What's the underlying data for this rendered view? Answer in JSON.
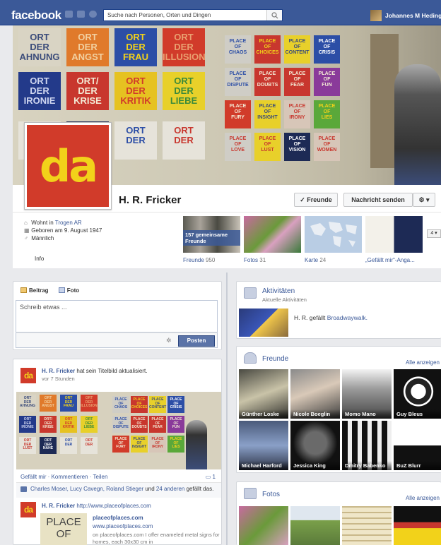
{
  "topbar": {
    "logo": "facebook",
    "search_placeholder": "Suche nach Personen, Orten und Dingen",
    "user_name": "Johannes M Hedinger"
  },
  "profile": {
    "name": "H. R. Fricker",
    "avatar_text": "da",
    "friends_button": "✓ Freunde",
    "message_button": "Nachricht senden",
    "gear_button": "⚙ ▾"
  },
  "cover": {
    "signs_left": [
      {
        "text": "ORT DER AHNUNG",
        "color": "#d9d4c4",
        "fg": "#3b4c7a"
      },
      {
        "text": "ORT DER ANGST",
        "color": "#e07a2b",
        "fg": "#f2d0a0"
      },
      {
        "text": "ORT DER FRAU",
        "color": "#2c4ea6",
        "fg": "#f2d21a"
      },
      {
        "text": "ORT DER ILLUSION",
        "color": "#d13b2a",
        "fg": "#e9a070"
      },
      {
        "text": "ORT DER IRONIE",
        "color": "#233a8a",
        "fg": "#cfd6f0"
      },
      {
        "text": "ORT/ DER KRISE",
        "color": "#c8372e",
        "fg": "#f3ead5"
      },
      {
        "text": "ORT DER KRITIK",
        "color": "#e6c221",
        "fg": "#d13b2a"
      },
      {
        "text": "ORT DER LIEBE",
        "color": "#e8d02a",
        "fg": "#3b8a3a"
      },
      {
        "text": "ORT DER LUST",
        "color": "#e6e3da",
        "fg": "#c8372e"
      },
      {
        "text": "ORT DER NÄHE",
        "color": "#1d2a55",
        "fg": "#ffffff"
      },
      {
        "text": "ORT DER",
        "color": "#e6e3da",
        "fg": "#2c4ea6"
      },
      {
        "text": "ORT DER",
        "color": "#e6e3da",
        "fg": "#c8372e"
      }
    ],
    "signs_right": [
      {
        "text": "PLACE OF CHAOS",
        "color": "#cfcdc6",
        "fg": "#2c4ea6"
      },
      {
        "text": "PLACE OF CHOICES",
        "color": "#c8372e",
        "fg": "#f2d21a"
      },
      {
        "text": "PLACE OF CONTENT",
        "color": "#e8d02a",
        "fg": "#3b4c7a"
      },
      {
        "text": "PLACE OF CRISIS",
        "color": "#2c4ea6",
        "fg": "#ffffff"
      },
      {
        "text": "PLACE OF DISPUTE",
        "color": "#cfcdc6",
        "fg": "#2c4ea6"
      },
      {
        "text": "PLACE OF DOUBTS",
        "color": "#c8372e",
        "fg": "#f3ead5"
      },
      {
        "text": "PLACE OF FEAR",
        "color": "#c8372e",
        "fg": "#f3ead5"
      },
      {
        "text": "PLACE OF FUN",
        "color": "#8a3a9a",
        "fg": "#f3ead5"
      },
      {
        "text": "PLACE OF FURY",
        "color": "#d13b2a",
        "fg": "#f3ead5"
      },
      {
        "text": "PLACE OF INSIGHT",
        "color": "#e8d02a",
        "fg": "#3b4c7a"
      },
      {
        "text": "PLACE OF IRONY",
        "color": "#d7c6b8",
        "fg": "#c8372e"
      },
      {
        "text": "PLACE OF LIES",
        "color": "#5aa83a",
        "fg": "#f2d21a"
      },
      {
        "text": "PLACE OF LOVE",
        "color": "#cfcdc6",
        "fg": "#c8372e"
      },
      {
        "text": "PLACE OF LUST",
        "color": "#e8d02a",
        "fg": "#c8372e"
      },
      {
        "text": "PLACE OF VISION",
        "color": "#1d2a55",
        "fg": "#ffffff"
      },
      {
        "text": "PLACE OF WOMEN",
        "color": "#d7c6b8",
        "fg": "#c8372e"
      }
    ]
  },
  "info": {
    "lives_prefix": "Wohnt in",
    "lives_place": "Trogen AR",
    "born": "Geboren am 9. August 1947",
    "gender": "Männlich",
    "tab_info": "Info"
  },
  "thumbs": {
    "friends_overlay": "157 gemeinsame Freunde",
    "friends_label": "Freunde",
    "friends_count": "950",
    "photos_label": "Fotos",
    "photos_count": "31",
    "map_label": "Karte",
    "map_count": "24",
    "likes_label": "„Gefällt mir“-Anga...",
    "more_label": "4 ▾"
  },
  "composer": {
    "tab_post": "Beitrag",
    "tab_photo": "Foto",
    "placeholder": "Schreib etwas ...",
    "post_button": "Posten"
  },
  "feed": {
    "author": "H. R. Fricker",
    "action": " hat sein Titelbild aktualisiert.",
    "time": "vor 7 Stunden",
    "actions": "Gefällt mir · Kommentieren · Teilen",
    "comment_count": "1",
    "likes_names": "Charles Moser, Lucy Cavegn, Roland Stieger",
    "likes_and": " und ",
    "likes_others": "24 anderen",
    "likes_suffix": " gefällt das.",
    "post2_author": "H. R. Fricker",
    "post2_url": "http://www.placeofplaces.com",
    "preview_pic": "PLACE OF",
    "preview_title": "placeofplaces.com",
    "preview_url": "www.placeofplaces.com",
    "preview_desc": "on placeofplaces.com I offer enameled metal signs for homes, each 30x30 cm in"
  },
  "activities": {
    "title": "Aktivitäten",
    "subtitle": "Aktuelle Aktivitäten",
    "actor": "H. R.",
    "verb": " gefällt ",
    "object": "Broadwaywalk."
  },
  "friends": {
    "title": "Freunde",
    "see_all": "Alle anzeigen",
    "items": [
      {
        "name": "Günther Loske",
        "bg": "linear-gradient(160deg,#4a4a42,#c9c3a8 50%,#2e2e2a)"
      },
      {
        "name": "Nicole Boeglin",
        "bg": "linear-gradient(160deg,#8a8a8a,#d9c9b8 45%,#3a3a3a)"
      },
      {
        "name": "Momo Mano",
        "bg": "linear-gradient(180deg,#f3f3f3,#9a9a9a 40%,#444)"
      },
      {
        "name": "Guy Bleus",
        "bg": "radial-gradient(circle at 50% 45%,#fff 0 20%,#222 21% 35%,#fff 36% 40%,#111 41%)"
      },
      {
        "name": "Michael Harford",
        "bg": "linear-gradient(180deg,#4a5a7a,#8aa0c8 50%,#2a3042)"
      },
      {
        "name": "Jessica King",
        "bg": "radial-gradient(circle at 50% 45%,#6a6a6a 0 30%,#111 60%)"
      },
      {
        "name": "Dmitry Babenko",
        "bg": "repeating-linear-gradient(90deg,#111 0 8px,#eee 8px 14px)"
      },
      {
        "name": "BuZ Blurr",
        "bg": "linear-gradient(180deg,#fff 0 50%,#111 50%)"
      }
    ]
  },
  "photos": {
    "title": "Fotos",
    "see_all": "Alle anzeigen",
    "items": [
      {
        "bg": "linear-gradient(135deg,#c86aa0,#6a9a3a 50%,#d9a0c0)"
      },
      {
        "bg": "linear-gradient(180deg,#dfe7ef 0 35%,#7aa04a 36%,#5a7a3a)"
      },
      {
        "bg": "repeating-linear-gradient(0deg,#efe6c8 0 6px,#c9b88a 6px 8px)"
      },
      {
        "bg": "linear-gradient(180deg,#111 0 40%,#c8372e 41% 55%,#f2d21a 56%)"
      }
    ]
  }
}
